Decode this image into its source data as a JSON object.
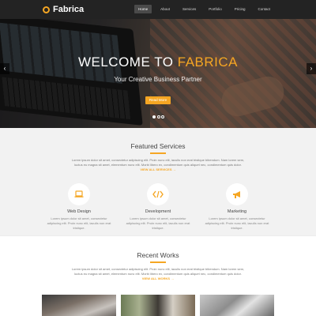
{
  "nav": {
    "brand": "Fabrica",
    "items": [
      {
        "label": "Home",
        "active": true
      },
      {
        "label": "About",
        "active": false
      },
      {
        "label": "Services",
        "active": false
      },
      {
        "label": "Portfolio",
        "active": false
      },
      {
        "label": "Pricing",
        "active": false
      },
      {
        "label": "Contact",
        "active": false
      }
    ]
  },
  "hero": {
    "title_prefix": "WELCOME TO",
    "title_accent": "FABRICA",
    "subtitle": "Your Creative Business Partner",
    "button": "Read More",
    "prev_icon": "chevron-left-icon",
    "next_icon": "chevron-right-icon",
    "slides": 3,
    "active_slide": 1
  },
  "services": {
    "title": "Featured Services",
    "text": "Lorem ipsum dolor sit amet, consectetur adipiscing elit. Proin nunc elit, iaculis non erat tristique bibendum. Nam lorem sem, luctus eu magna sit amet, elementum nunc elit. Morbi libero ex, condimentum quis aliquet nec, condimentum quis dolor.",
    "link": "VIEW ALL SERVICES →",
    "items": [
      {
        "icon": "laptop-icon",
        "title": "Web Design",
        "text": "Lorem ipsum dolor sit amet, consectetur adipiscing elit. Proin nunc elit, iaculis non erat tristique."
      },
      {
        "icon": "code-icon",
        "title": "Development",
        "text": "Lorem ipsum dolor sit amet, consectetur adipiscing elit. Proin nunc elit, iaculis non erat tristique."
      },
      {
        "icon": "megaphone-icon",
        "title": "Marketing",
        "text": "Lorem ipsum dolor sit amet, consectetur adipiscing elit. Proin nunc elit, iaculis non erat tristique."
      }
    ]
  },
  "works": {
    "title": "Recent Works",
    "text": "Lorem ipsum dolor sit amet, consectetur adipiscing elit. Proin nunc elit, iaculis non erat tristique bibendum. Nam lorem sem, luctus eu magna sit amet, elementum nunc elit. Morbi libero ex, condimentum quis aliquet nec, condimentum quis dolor.",
    "link": "VIEW ALL WORKS →"
  },
  "colors": {
    "accent": "#f5a623",
    "nav_bg": "#232323",
    "services_bg": "#f2f2f2"
  }
}
